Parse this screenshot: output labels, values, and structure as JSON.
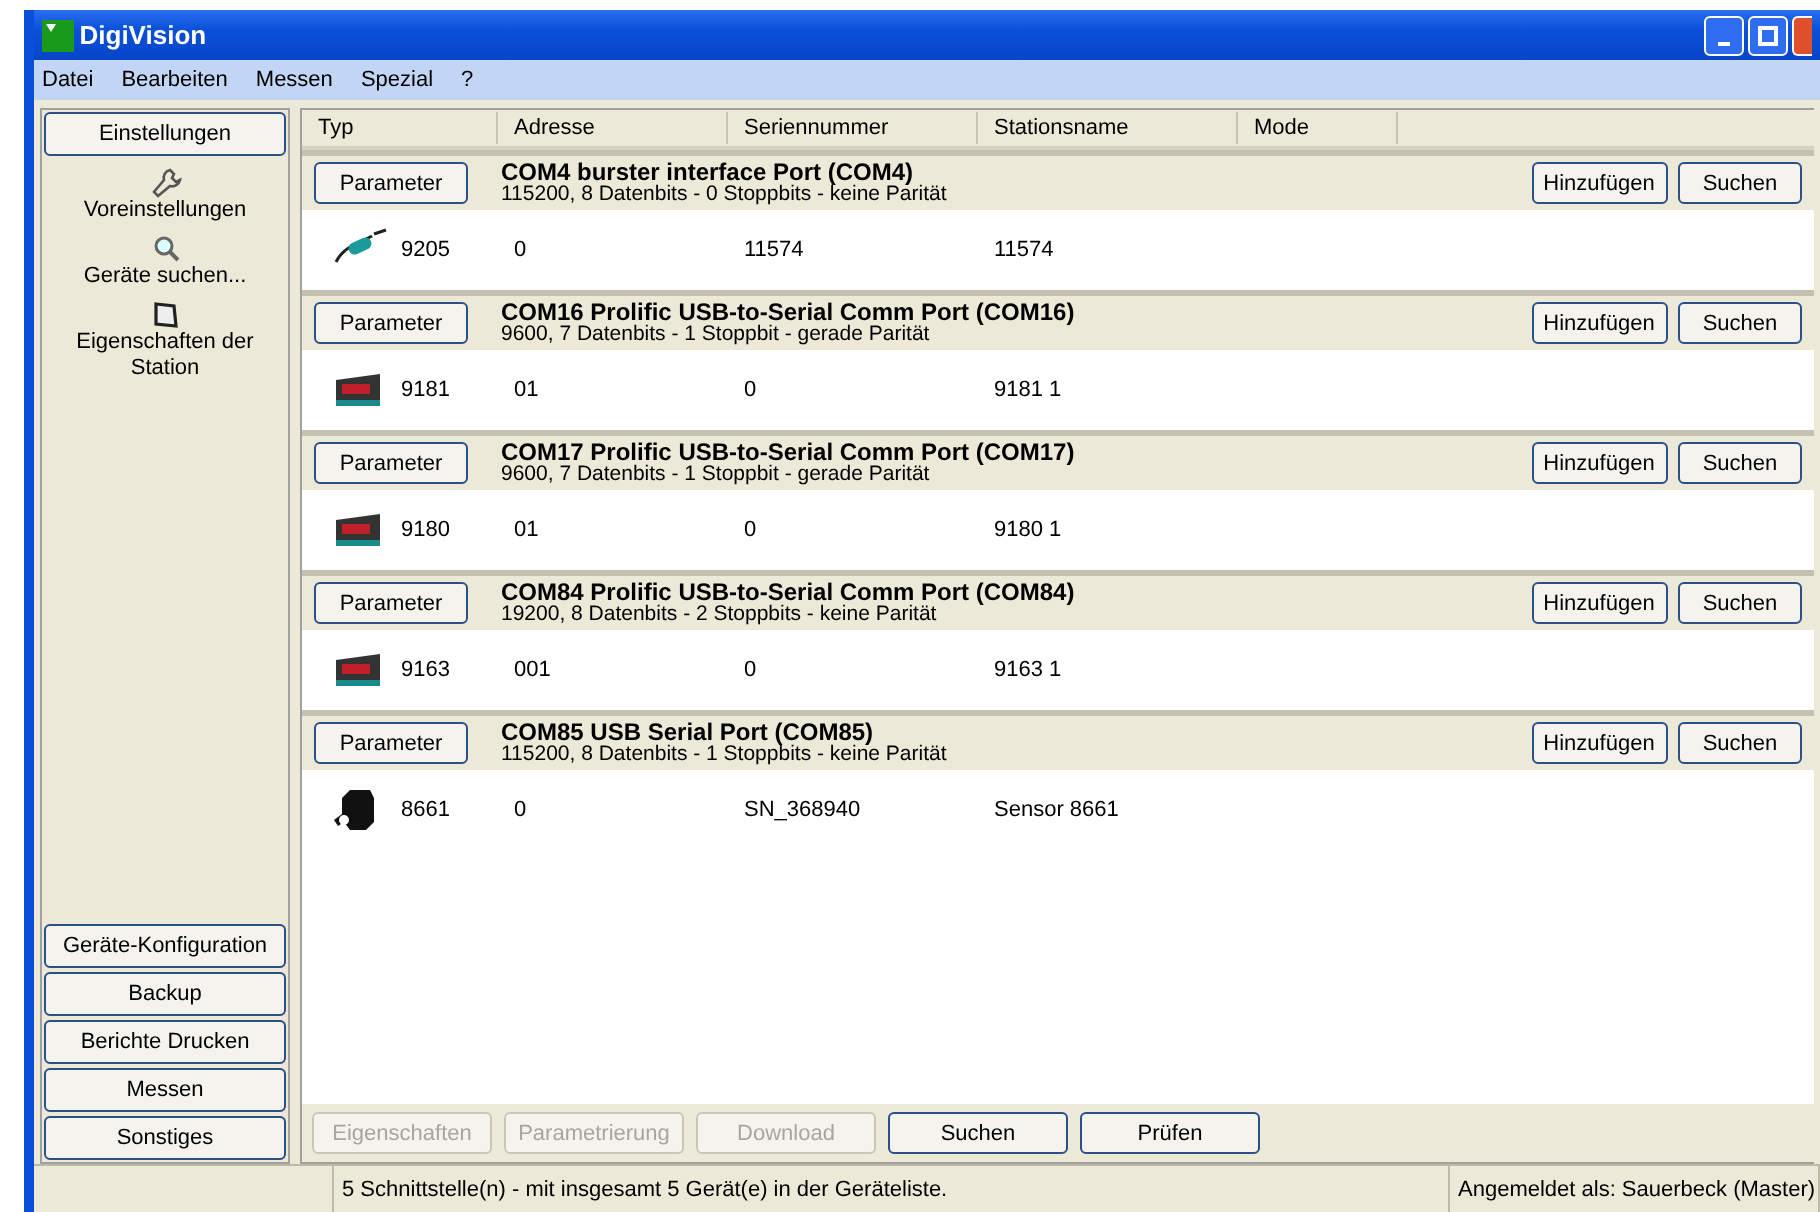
{
  "window": {
    "title": "DigiVision"
  },
  "menu": [
    "Datei",
    "Bearbeiten",
    "Messen",
    "Spezial",
    "?"
  ],
  "sidebar": {
    "header": "Einstellungen",
    "items": [
      {
        "kind": "wrench",
        "label": "Voreinstellungen"
      },
      {
        "kind": "search",
        "label": "Geräte suchen..."
      },
      {
        "kind": "station",
        "label": "Eigenschaften der Station"
      }
    ],
    "buttons": [
      "Geräte-Konfiguration",
      "Backup",
      "Berichte Drucken",
      "Messen",
      "Sonstiges"
    ]
  },
  "table": {
    "columns": [
      "Typ",
      "Adresse",
      "Seriennummer",
      "Stationsname",
      "Mode"
    ],
    "ports": [
      {
        "button": "Parameter",
        "title": "COM4 burster interface Port (COM4)",
        "settings": "115200, 8 Datenbits - 0 Stoppbits - keine Parität",
        "add": "Hinzufügen",
        "search": "Suchen",
        "device": {
          "kind": "cable",
          "type": "9205",
          "address": "0",
          "serial": "11574",
          "station": "11574"
        }
      },
      {
        "button": "Parameter",
        "title": "COM16 Prolific USB-to-Serial Comm Port (COM16)",
        "settings": "9600, 7 Datenbits - 1 Stoppbit - gerade Parität",
        "add": "Hinzufügen",
        "search": "Suchen",
        "device": {
          "kind": "display",
          "type": "9181",
          "address": "01",
          "serial": "0",
          "station": "9181 1"
        }
      },
      {
        "button": "Parameter",
        "title": "COM17 Prolific USB-to-Serial Comm Port (COM17)",
        "settings": "9600, 7 Datenbits - 1 Stoppbit - gerade Parität",
        "add": "Hinzufügen",
        "search": "Suchen",
        "device": {
          "kind": "display",
          "type": "9180",
          "address": "01",
          "serial": "0",
          "station": "9180 1"
        }
      },
      {
        "button": "Parameter",
        "title": "COM84 Prolific USB-to-Serial Comm Port (COM84)",
        "settings": "19200, 8 Datenbits - 2 Stoppbits - keine Parität",
        "add": "Hinzufügen",
        "search": "Suchen",
        "device": {
          "kind": "display",
          "type": "9163",
          "address": "001",
          "serial": "0",
          "station": "9163 1"
        }
      },
      {
        "button": "Parameter",
        "title": "COM85 USB Serial Port (COM85)",
        "settings": "115200, 8 Datenbits - 1 Stoppbits - keine Parität",
        "add": "Hinzufügen",
        "search": "Suchen",
        "device": {
          "kind": "sensor",
          "type": "8661",
          "address": "0",
          "serial": "SN_368940",
          "station": "Sensor 8661"
        }
      }
    ]
  },
  "actions": [
    {
      "label": "Eigenschaften",
      "disabled": true
    },
    {
      "label": "Parametrierung",
      "disabled": true
    },
    {
      "label": "Download",
      "disabled": true
    },
    {
      "label": "Suchen",
      "disabled": false
    },
    {
      "label": "Prüfen",
      "disabled": false
    }
  ],
  "status_bar": {
    "message": "5 Schnittstelle(n) - mit insgesamt 5 Gerät(e) in der Geräteliste.",
    "user": "Angemeldet als: Sauerbeck (Master)"
  }
}
